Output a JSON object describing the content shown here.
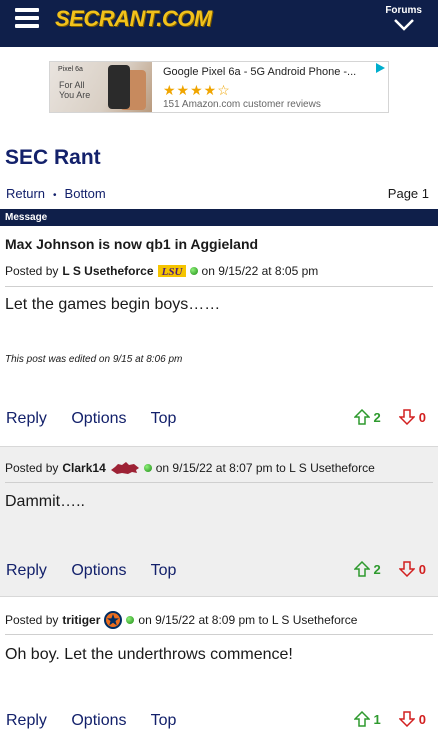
{
  "header": {
    "logo": "SECRANT.COM",
    "forums_label": "Forums"
  },
  "ad": {
    "image_brand": "Pixel 6a",
    "image_tagline": "For All You Are",
    "title": "Google Pixel 6a - 5G Android Phone -...",
    "stars": "★★★★☆",
    "reviews": "151 Amazon.com customer reviews"
  },
  "page": {
    "title": "SEC Rant",
    "nav_return": "Return",
    "nav_dot": "•",
    "nav_bottom": "Bottom",
    "page_number": "Page 1",
    "message_header": "Message"
  },
  "thread": {
    "title": "Max Johnson is now qb1 in Aggieland"
  },
  "posts": [
    {
      "posted_by": "Posted by",
      "user": "L S Usetheforce",
      "flair": "LSU",
      "meta": "on 9/15/22 at 8:05 pm",
      "body": "Let the games begin boys……",
      "edited": "This post was edited on 9/15 at 8:06 pm",
      "reply": "Reply",
      "options": "Options",
      "top": "Top",
      "upvotes": "2",
      "downvotes": "0"
    },
    {
      "posted_by": "Posted by",
      "user": "Clark14",
      "flair": "Arkansas",
      "meta": "on 9/15/22 at 8:07 pm to L S Usetheforce",
      "body": "Dammit…..",
      "reply": "Reply",
      "options": "Options",
      "top": "Top",
      "upvotes": "2",
      "downvotes": "0"
    },
    {
      "posted_by": "Posted by",
      "user": "tritiger",
      "flair": "Astros",
      "meta": "on 9/15/22 at 8:09 pm to L S Usetheforce",
      "body": "Oh boy. Let the underthrows commence!",
      "reply": "Reply",
      "options": "Options",
      "top": "Top",
      "upvotes": "1",
      "downvotes": "0"
    }
  ],
  "colors": {
    "navy": "#0f1f4a",
    "link": "#13216b",
    "logo_gold": "#f2c21b",
    "upvote": "#2e9a2e",
    "downvote": "#d22020"
  }
}
